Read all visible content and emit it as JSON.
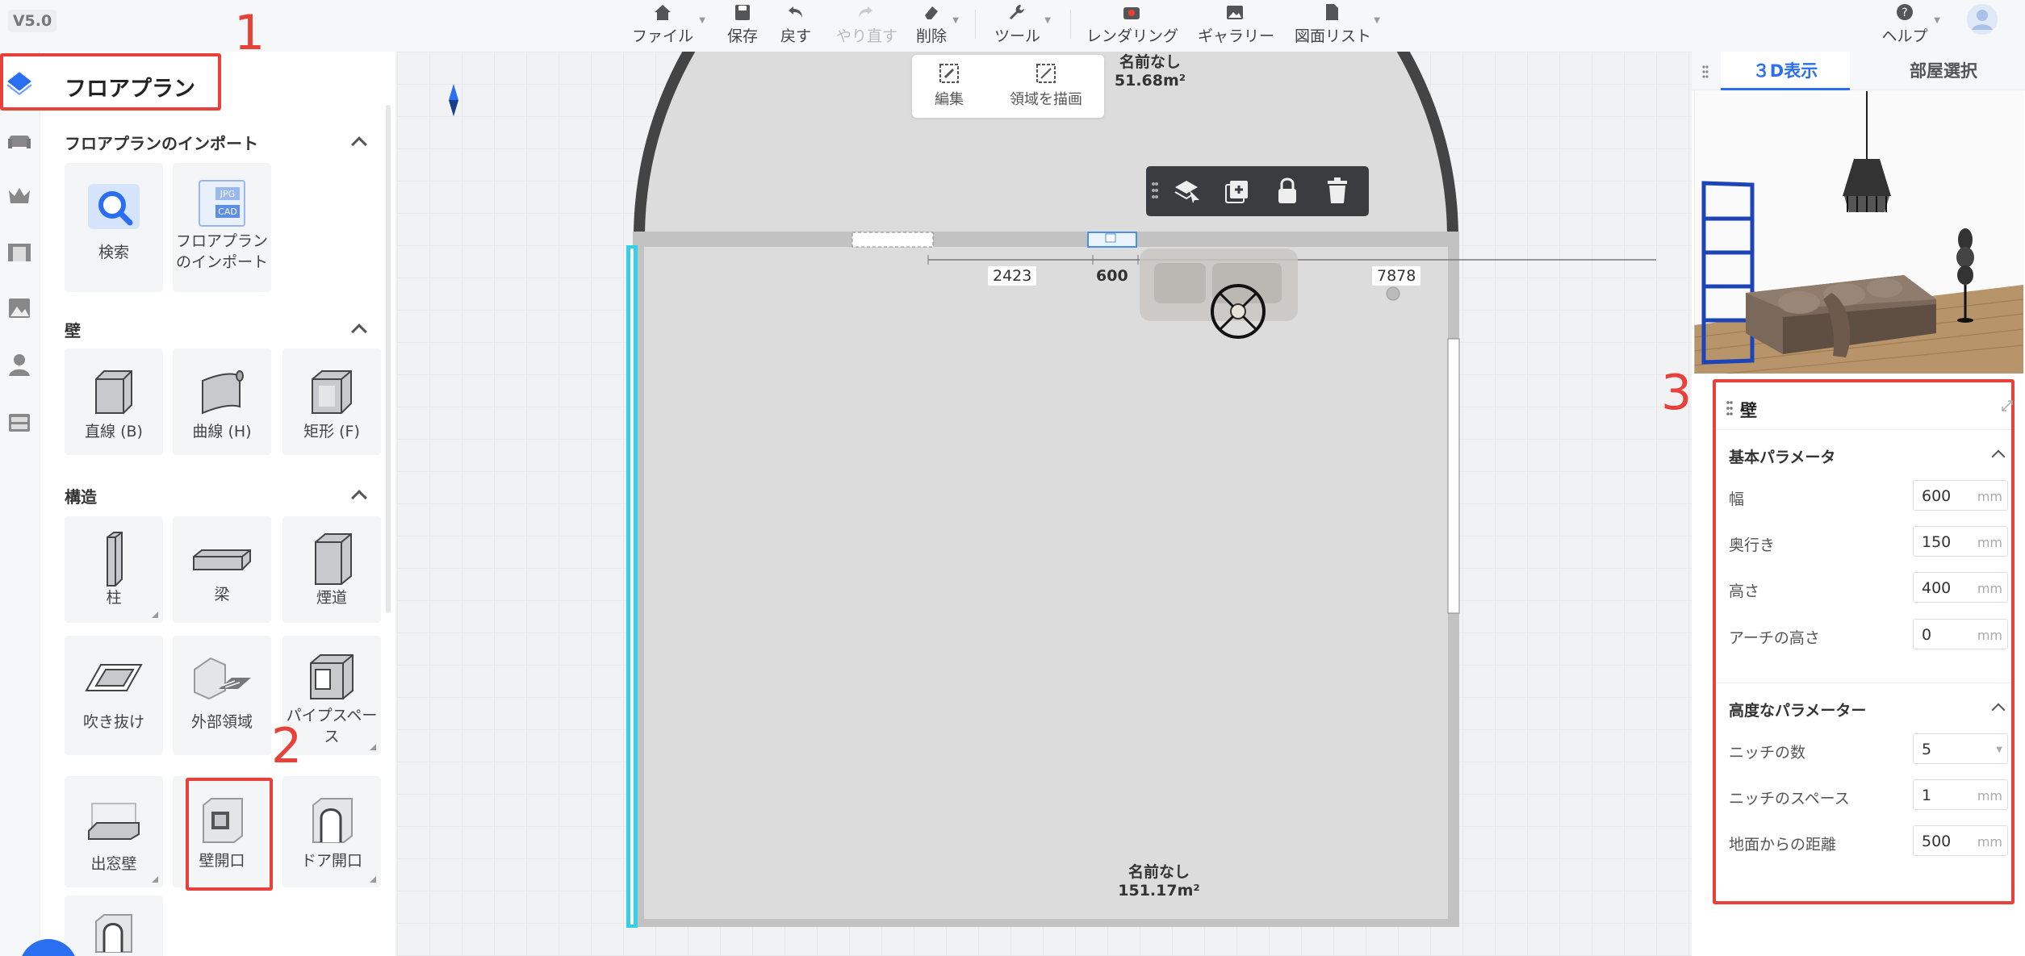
{
  "version": "V5.0",
  "toolbar": {
    "file": "ファイル",
    "save": "保存",
    "undo": "戻す",
    "redo": "やり直す",
    "delete": "削除",
    "tools": "ツール",
    "render": "レンダリング",
    "gallery": "ギャラリー",
    "drawings": "図面リスト",
    "help": "ヘルプ"
  },
  "left_panel": {
    "title": "フロアプラン",
    "sections": {
      "import": "フロアプランのインポート",
      "wall": "壁",
      "structure": "構造"
    },
    "import_items": [
      "検索",
      "フロアプラン",
      "のインポート"
    ],
    "wall_items": [
      "直線 (B)",
      "曲線 (H)",
      "矩形 (F)"
    ],
    "structure_items": [
      "柱",
      "梁",
      "煙道",
      "吹き抜け",
      "外部領域",
      "パイプスペー",
      "ス",
      "出窓壁",
      "壁開口",
      "ドア開口"
    ],
    "thumb_text": {
      "jpg": "JPG",
      "cad": "CAD"
    }
  },
  "annotations": [
    "1",
    "2",
    "3"
  ],
  "canvas": {
    "float_toolbar": {
      "edit": "編集",
      "draw_area": "領域を描画"
    },
    "room_top": {
      "name": "名前なし",
      "area": "51.68m²"
    },
    "room_main": {
      "name": "名前なし",
      "area": "151.17m²"
    },
    "dimensions": [
      "2423",
      "600",
      "7878"
    ]
  },
  "right_panel": {
    "tabs": {
      "view3d": "３D表示",
      "room_select": "部屋選択"
    },
    "panel_title": "壁",
    "basic_params": "基本パラメータ",
    "advanced_params": "高度なパラメーター",
    "fields": [
      {
        "label": "幅",
        "value": "600",
        "unit": "mm"
      },
      {
        "label": "奥行き",
        "value": "150",
        "unit": "mm"
      },
      {
        "label": "高さ",
        "value": "400",
        "unit": "mm"
      },
      {
        "label": "アーチの高さ",
        "value": "0",
        "unit": "mm"
      }
    ],
    "adv_fields": [
      {
        "label": "ニッチの数",
        "value": "5",
        "unit": ""
      },
      {
        "label": "ニッチのスペース",
        "value": "1",
        "unit": "mm"
      },
      {
        "label": "地面からの距離",
        "value": "500",
        "unit": "mm"
      }
    ]
  },
  "colors": {
    "accent": "#2a6ff0",
    "annotation": "#e8413a",
    "selected_wall": "#35d0e8"
  }
}
